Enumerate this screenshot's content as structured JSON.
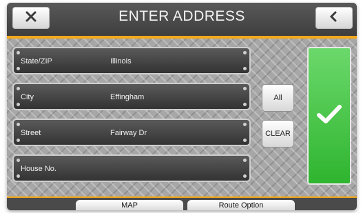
{
  "header": {
    "title": "ENTER ADDRESS",
    "close_icon": "x-icon",
    "back_icon": "chevron-left-icon"
  },
  "fields": [
    {
      "label": "State/ZIP",
      "value": "Illinois"
    },
    {
      "label": "City",
      "value": "Effingham"
    },
    {
      "label": "Street",
      "value": "Fairway Dr"
    },
    {
      "label": "House No.",
      "value": ""
    }
  ],
  "buttons": {
    "all_label": "All",
    "clear_label": "CLEAR",
    "confirm_icon": "checkmark-icon"
  },
  "footer": {
    "tabs": [
      "MAP",
      "Route Option"
    ]
  },
  "colors": {
    "accent": "#f2a81d",
    "confirm": "#3fbf3f"
  }
}
